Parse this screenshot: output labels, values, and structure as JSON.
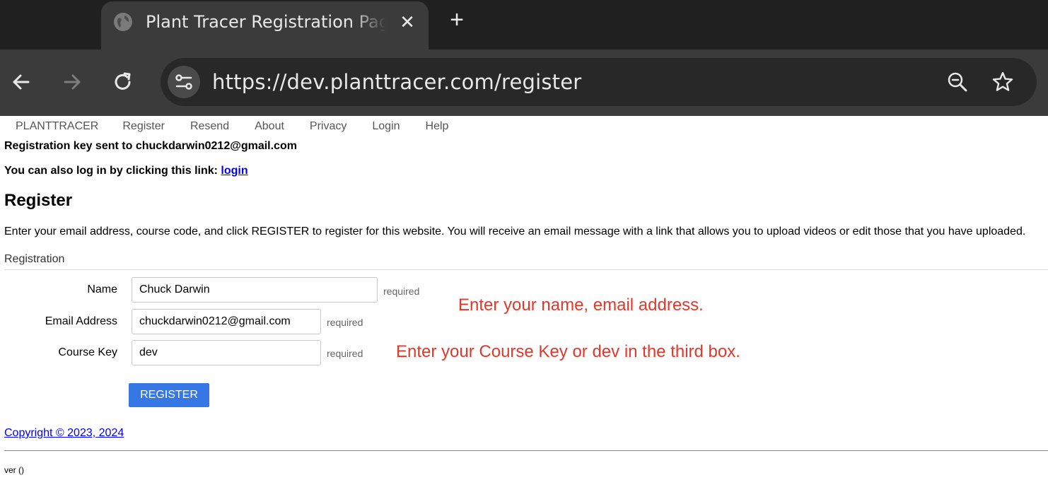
{
  "browser": {
    "tab_title": "Plant Tracer Registration Page",
    "url": "https://dev.planttracer.com/register"
  },
  "nav": {
    "brand": "PLANTTRACER",
    "items": [
      "Register",
      "Resend",
      "About",
      "Privacy",
      "Login",
      "Help"
    ]
  },
  "messages": {
    "sent": "Registration key sent to chuckdarwin0212@gmail.com",
    "login_prefix": "You can also log in by clicking this link: ",
    "login_link": "login"
  },
  "page": {
    "heading": "Register",
    "intro": "Enter your email address, course code, and click REGISTER to register for this website. You will receive an email message with a link that allows you to upload videos or edit those that you have uploaded.",
    "legend": "Registration"
  },
  "form": {
    "name_label": "Name",
    "name_value": "Chuck Darwin",
    "email_label": "Email Address",
    "email_value": "chuckdarwin0212@gmail.com",
    "course_label": "Course Key",
    "course_value": "dev",
    "required": "required",
    "submit": "REGISTER"
  },
  "annotations": {
    "name_email_hint": "Enter your name, email address.",
    "course_hint": "Enter your Course Key or dev in the third box."
  },
  "footer": {
    "copyright": "Copyright © 2023, 2024",
    "version": "ver ()"
  },
  "colors": {
    "accent_button": "#3578e5",
    "hint_red": "#e0392b",
    "link": "#0000ee"
  }
}
